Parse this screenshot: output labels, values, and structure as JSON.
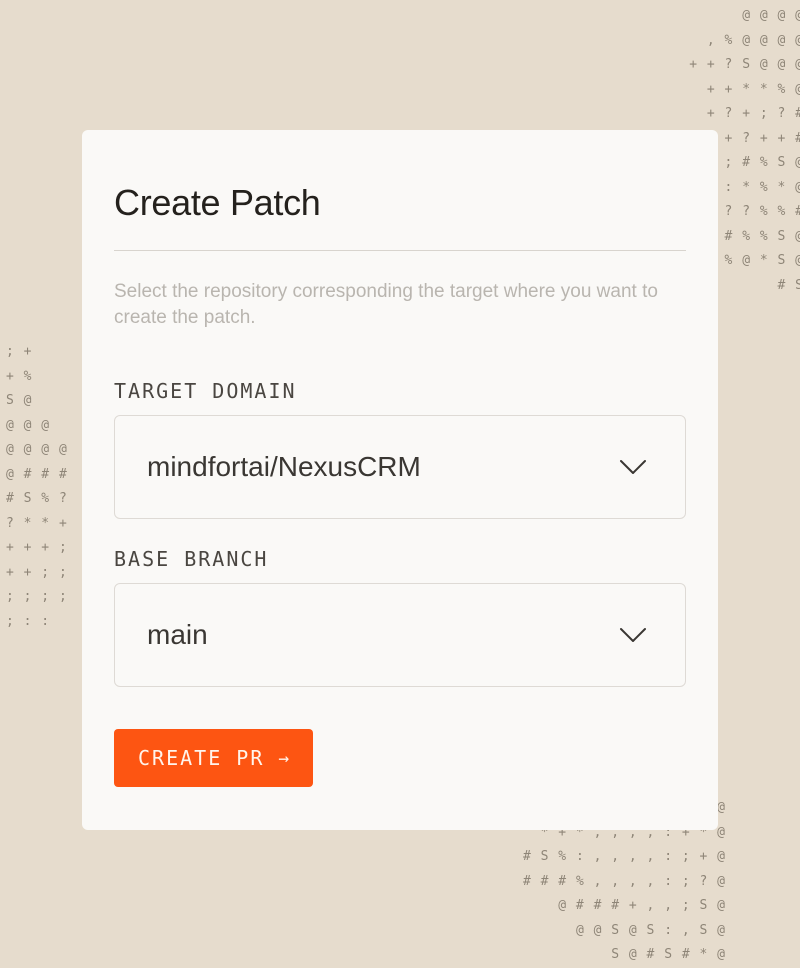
{
  "background_ascii": {
    "top_right": "@ @ @ @\n, % @ @ @ @\n+ + ? S @ @ @\n+ + * * % @\n+ ? + ; ? #\n+ ? + ? + + #\n+ ; ; ; ; # % S @\n+ + ; ; : * % * @\n; ? ? % % #\n? # % % S @\n% @ * S @\n# S",
    "middle_left": "; +\n+ %\nS @\n@ @ @\n@ @ @ @\n@ # # #\n# S % ?\n? * * +\n+ + + ;\n+ + ; ;\n; ; ; ;\n; : :",
    "bottom_right": "@\n* + * , , , , : + * @\n# S % : , , , , : ; + @\n# # # % , , , , : ; ? @\n@ # # # + , , ; S @\n@ @ S @ S : , S @\nS @ # S # * @"
  },
  "dialog": {
    "title": "Create Patch",
    "description": "Select the repository corresponding the target where you want to create the patch.",
    "target_domain": {
      "label": "TARGET DOMAIN",
      "value": "mindfortai/NexusCRM",
      "icon": "chevron-down-icon"
    },
    "base_branch": {
      "label": "BASE BRANCH",
      "value": "main",
      "icon": "chevron-down-icon"
    },
    "submit": {
      "label": "CREATE PR",
      "icon_glyph": "→",
      "color": "#fd5512"
    }
  }
}
